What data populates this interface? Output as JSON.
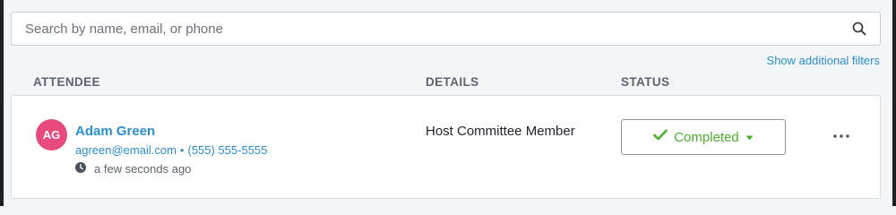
{
  "search": {
    "placeholder": "Search by name, email, or phone",
    "icon": "search-icon"
  },
  "filters_link": "Show additional filters",
  "columns": {
    "attendee": "ATTENDEE",
    "details": "DETAILS",
    "status": "STATUS"
  },
  "attendee_row": {
    "initials": "AG",
    "avatar_color": "#e84a7d",
    "name": "Adam Green",
    "email": "agreen@email.com",
    "separator": "•",
    "phone": "(555) 555-5555",
    "timestamp": "a few seconds ago",
    "timestamp_icon": "clock-icon",
    "details": "Host Committee Member",
    "status": "Completed",
    "status_color": "#4caf2e",
    "status_icon": "check-icon",
    "dropdown_icon": "caret-down-icon",
    "more_icon": "more-horizontal-icon"
  },
  "colors": {
    "link": "#2a8ecf",
    "header_text": "#5b6470",
    "background": "#f4f5f7"
  }
}
